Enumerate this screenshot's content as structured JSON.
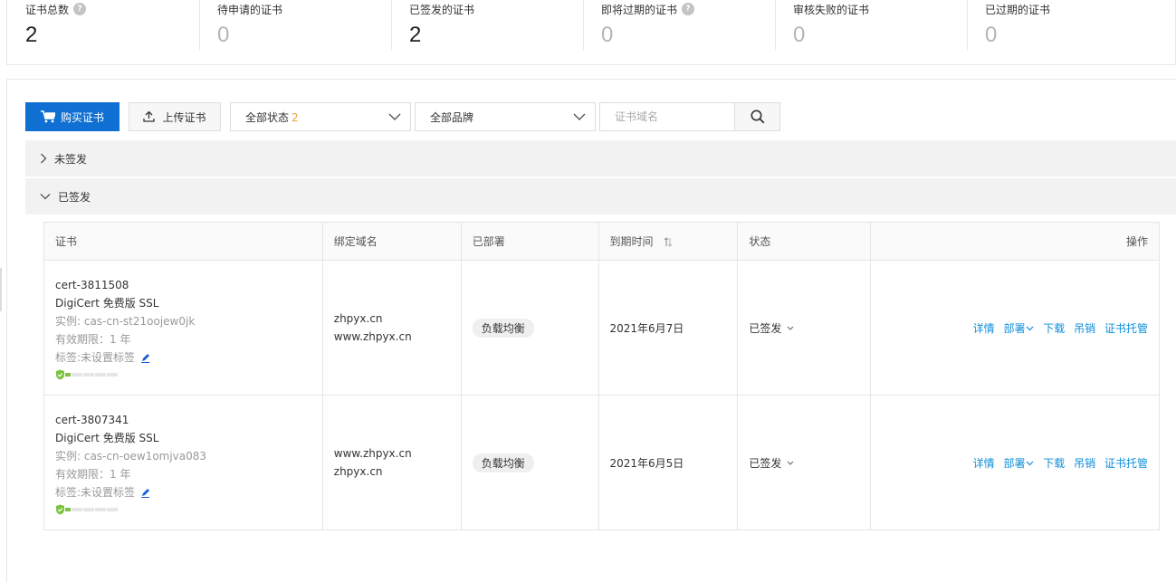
{
  "stats": [
    {
      "label": "证书总数",
      "value": "2",
      "help": true
    },
    {
      "label": "待申请的证书",
      "value": "0"
    },
    {
      "label": "已签发的证书",
      "value": "2"
    },
    {
      "label": "即将过期的证书",
      "value": "0",
      "help": true
    },
    {
      "label": "审核失败的证书",
      "value": "0"
    },
    {
      "label": "已过期的证书",
      "value": "0"
    }
  ],
  "help_mark": "?",
  "toolbar": {
    "buy_label": "购买证书",
    "upload_label": "上传证书",
    "status_select": "全部状态",
    "status_count": "2",
    "brand_select": "全部品牌",
    "search_placeholder": "证书域名"
  },
  "groups": {
    "unsigned": "未签发",
    "signed": "已签发"
  },
  "table": {
    "headers": {
      "cert": "证书",
      "domain": "绑定域名",
      "deployed": "已部署",
      "expire": "到期时间",
      "status": "状态",
      "ops": "操作"
    },
    "rows": [
      {
        "cert_id": "cert-3811508",
        "product": "DigiCert 免费版 SSL",
        "instance": "实例: cas-cn-st21oojew0jk",
        "validity": "有效期限：1 年",
        "tag": "标签:未设置标签",
        "domain_1": "zhpyx.cn",
        "domain_2": "www.zhpyx.cn",
        "deployed": "负载均衡",
        "expire": "2021年6月7日",
        "status": "已签发",
        "ops": {
          "detail": "详情",
          "deploy": "部署",
          "download": "下载",
          "revoke": "吊销",
          "host": "证书托管"
        }
      },
      {
        "cert_id": "cert-3807341",
        "product": "DigiCert 免费版 SSL",
        "instance": "实例: cas-cn-oew1omjva083",
        "validity": "有效期限：1 年",
        "tag": "标签:未设置标签",
        "domain_1": "www.zhpyx.cn",
        "domain_2": "zhpyx.cn",
        "deployed": "负载均衡",
        "expire": "2021年6月5日",
        "status": "已签发",
        "ops": {
          "detail": "详情",
          "deploy": "部署",
          "download": "下载",
          "revoke": "吊销",
          "host": "证书托管"
        }
      }
    ]
  },
  "colors": {
    "primary": "#0f6fd2",
    "link": "#0f8fdb",
    "count": "#f2a03b",
    "strength_on": "#7cc340"
  }
}
